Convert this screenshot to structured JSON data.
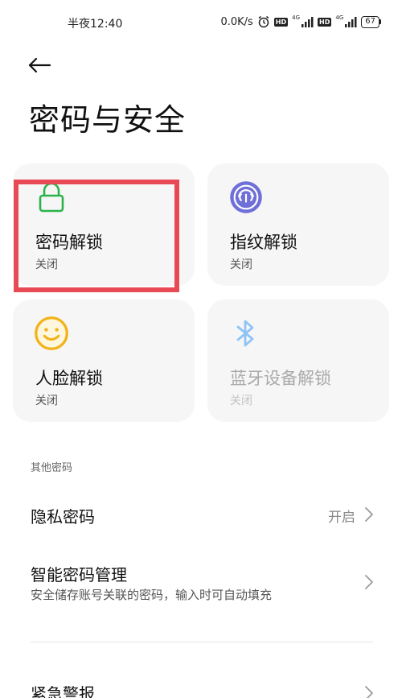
{
  "status_bar": {
    "time": "半夜12:40",
    "speed": "0.0K/s",
    "badge1": "HD",
    "badge2": "HD",
    "net1": "4G",
    "net2": "4G",
    "battery": "67"
  },
  "header": {
    "title": "密码与安全"
  },
  "cards": [
    {
      "title": "密码解锁",
      "status": "关闭",
      "icon": "lock-icon",
      "color": "#2bb34a"
    },
    {
      "title": "指纹解锁",
      "status": "关闭",
      "icon": "fingerprint-icon",
      "color": "#6e6fd8"
    },
    {
      "title": "人脸解锁",
      "status": "关闭",
      "icon": "smiley-face-icon",
      "color": "#f2b21a"
    },
    {
      "title": "蓝牙设备解锁",
      "status": "关闭",
      "icon": "bluetooth-icon",
      "color": "#8fc3f5"
    }
  ],
  "section": {
    "label": "其他密码"
  },
  "rows": [
    {
      "title": "隐私密码",
      "value": "开启"
    },
    {
      "title": "智能密码管理",
      "subtitle": "安全储存账号关联的密码，输入时可自动填充"
    },
    {
      "title": "紧急警报"
    }
  ],
  "colors": {
    "highlight": "#e84a55",
    "card_bg": "#f6f6f6"
  }
}
